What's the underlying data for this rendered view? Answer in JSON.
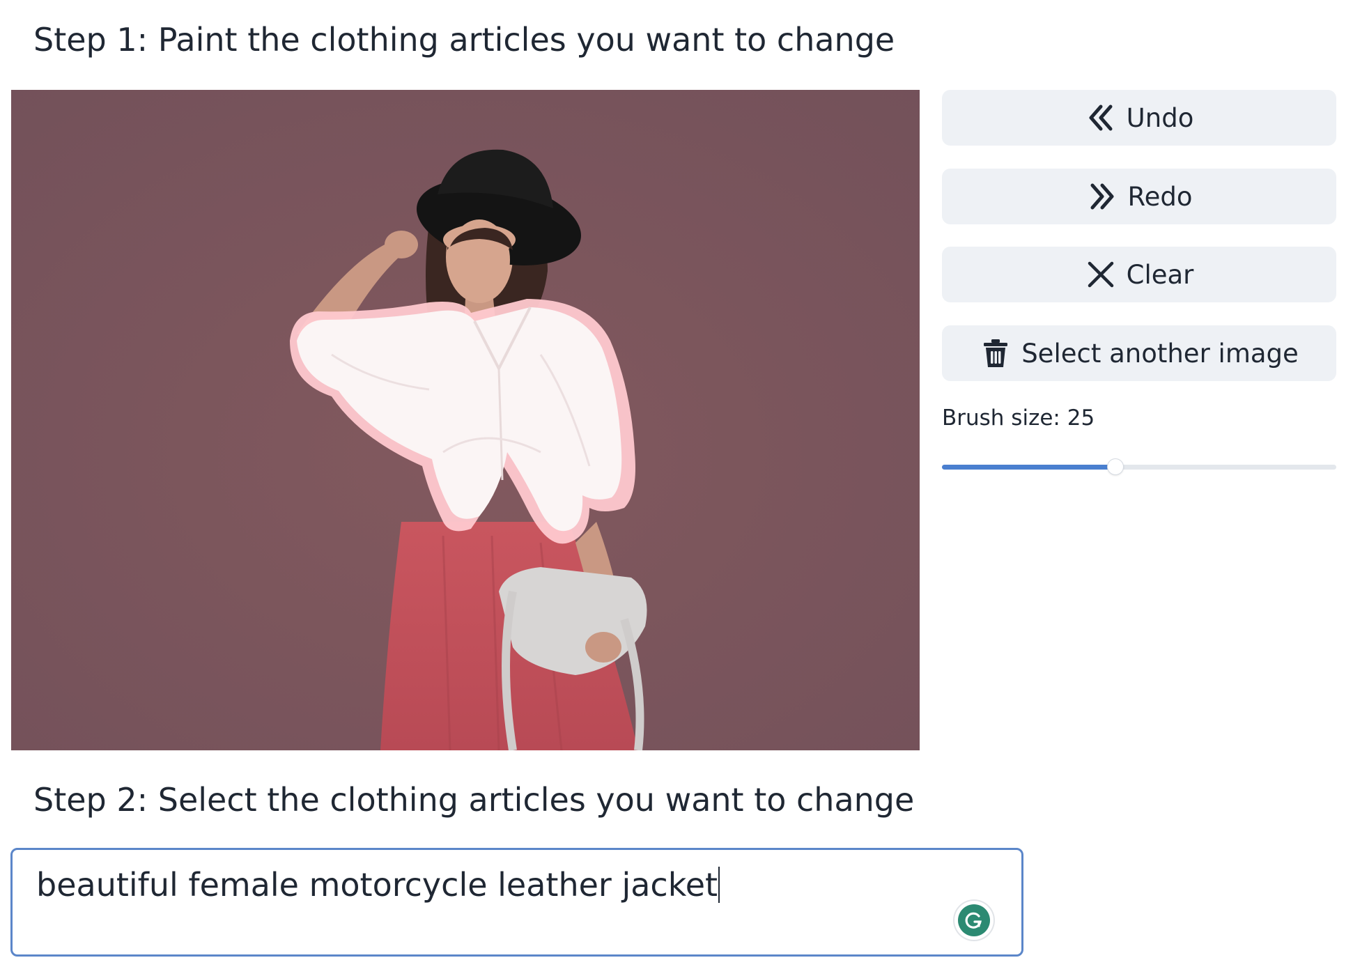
{
  "step1": {
    "title": "Step 1: Paint the clothing articles you want to change"
  },
  "toolbar": {
    "undo_label": "Undo",
    "redo_label": "Redo",
    "clear_label": "Clear",
    "select_image_label": "Select another image",
    "undo_icon": "double-chevron-left-icon",
    "redo_icon": "double-chevron-right-icon",
    "clear_icon": "close-icon",
    "select_image_icon": "trash-icon"
  },
  "brush": {
    "label": "Brush size: 25",
    "value": 25,
    "fraction": 0.44
  },
  "step2": {
    "title": "Step 2: Select the clothing articles you want to change",
    "prompt_value": "beautiful female motorcycle leather jacket"
  },
  "colors": {
    "accent": "#4a7fcf",
    "input_border": "#5b86c9",
    "button_bg": "#eef1f5",
    "background_photo": "#7b575b",
    "mask_paint": "#ffd0d4",
    "grammarly": "#2c8a72"
  }
}
